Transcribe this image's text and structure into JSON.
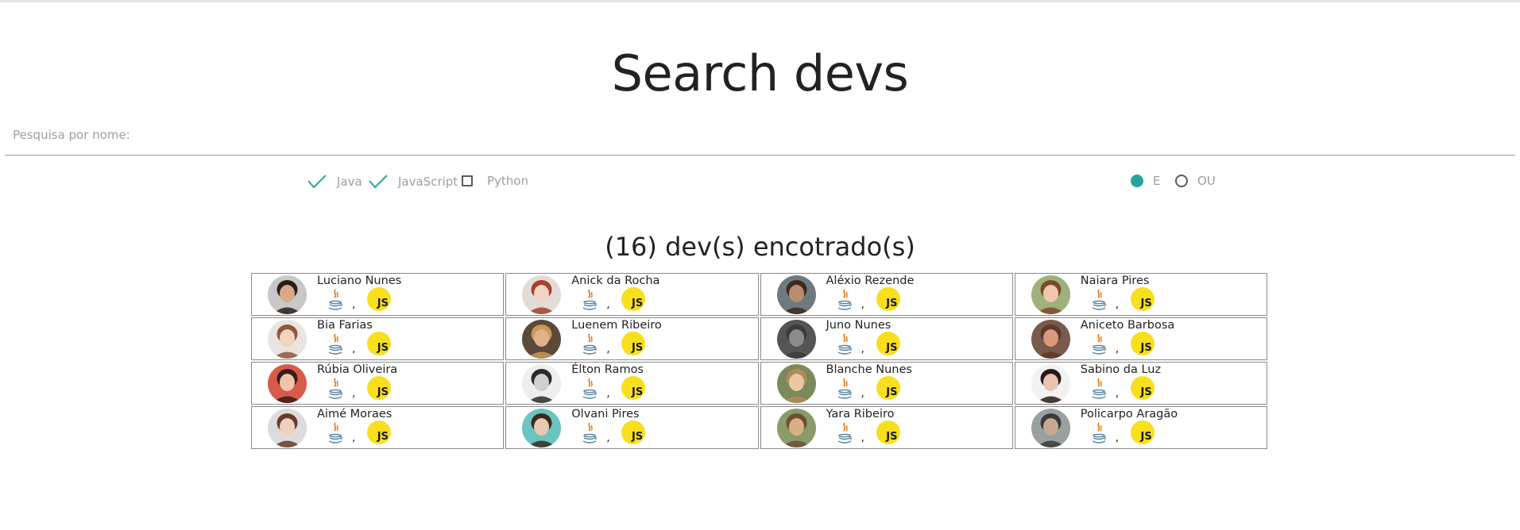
{
  "page": {
    "title": "Search devs"
  },
  "search": {
    "placeholder": "Pesquisa por nome:",
    "value": ""
  },
  "filters": {
    "languages": [
      {
        "label": "Java",
        "checked": true
      },
      {
        "label": "JavaScript",
        "checked": true
      },
      {
        "label": "Python",
        "checked": false
      }
    ],
    "logic": [
      {
        "label": "E",
        "selected": true
      },
      {
        "label": "OU",
        "selected": false
      }
    ]
  },
  "results": {
    "summary": "(16) dev(s) encotrado(s)",
    "devs": [
      {
        "name": "Luciano Nunes",
        "skin": "#d9a888",
        "hair": "#2a1f18",
        "bg": "#c8c8c8"
      },
      {
        "name": "Anick da Rocha",
        "skin": "#f0d4c4",
        "hair": "#a63f2c",
        "bg": "#e3dcd6"
      },
      {
        "name": "Aléxio Rezende",
        "skin": "#b98c70",
        "hair": "#3c2a1e",
        "bg": "#6f7a80"
      },
      {
        "name": "Naiara Pires",
        "skin": "#f0c8b0",
        "hair": "#7a4a2a",
        "bg": "#9fb17a"
      },
      {
        "name": "Bia Farias",
        "skin": "#f2d2c0",
        "hair": "#8b5a3a",
        "bg": "#e9e4e0"
      },
      {
        "name": "Luenem Ribeiro",
        "skin": "#e2b28c",
        "hair": "#c79a52",
        "bg": "#5b4a3a"
      },
      {
        "name": "Juno Nunes",
        "skin": "#8c8c8c",
        "hair": "#3c3c3c",
        "bg": "#555555"
      },
      {
        "name": "Aniceto Barbosa",
        "skin": "#d89a7a",
        "hair": "#5a3a2a",
        "bg": "#7a5a4a"
      },
      {
        "name": "Rúbia Oliveira",
        "skin": "#f0c4a8",
        "hair": "#3a1a1a",
        "bg": "#d85a4a"
      },
      {
        "name": "Élton Ramos",
        "skin": "#cfcfcf",
        "hair": "#2a2a2a",
        "bg": "#eeeeee"
      },
      {
        "name": "Blanche Nunes",
        "skin": "#e8c8a0",
        "hair": "#b08a5a",
        "bg": "#7a8a5a"
      },
      {
        "name": "Sabino da Luz",
        "skin": "#e8c4b0",
        "hair": "#2a1a14",
        "bg": "#f2f2f2"
      },
      {
        "name": "Aimé Moraes",
        "skin": "#f0d0c0",
        "hair": "#6a3a2a",
        "bg": "#dcdcdc"
      },
      {
        "name": "Olvani Pires",
        "skin": "#e8c8b0",
        "hair": "#3a2a1a",
        "bg": "#6ac4c0"
      },
      {
        "name": "Yara Ribeiro",
        "skin": "#d8b088",
        "hair": "#6a5030",
        "bg": "#8a9a6a"
      },
      {
        "name": "Policarpo Aragão",
        "skin": "#c8a890",
        "hair": "#3a3a3a",
        "bg": "#9aa0a0"
      }
    ],
    "skills": {
      "java_icon": "java-coffee-icon",
      "js_icon": "javascript-badge-icon",
      "js_text": "JS",
      "separator": ","
    }
  },
  "colors": {
    "accent": "#26a69a",
    "js_badge": "#f7df1e",
    "muted_text": "#9e9e9e"
  }
}
